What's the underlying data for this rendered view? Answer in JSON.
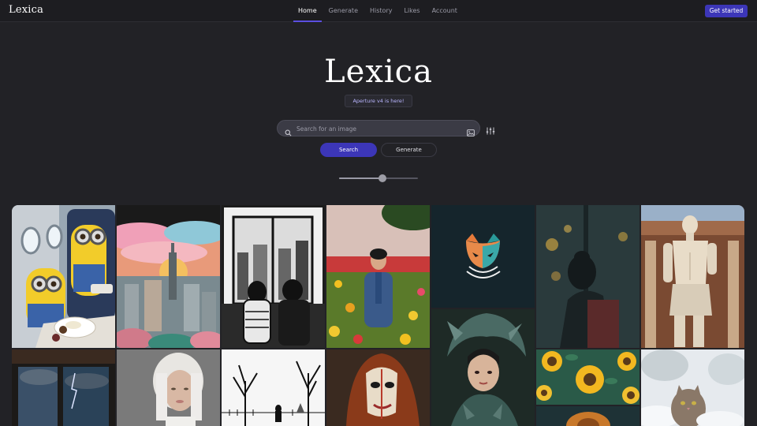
{
  "header": {
    "logo": "Lexica",
    "nav": [
      "Home",
      "Generate",
      "History",
      "Likes",
      "Account"
    ],
    "active_index": 0,
    "cta_label": "Get started"
  },
  "hero": {
    "logo": "Lexica",
    "announcement": "Aperture v4 is here!"
  },
  "search": {
    "placeholder": "Search for an image",
    "search_button": "Search",
    "generate_button": "Generate"
  },
  "size_slider": {
    "value": 0.55
  },
  "gallery": {
    "images": [
      "minions-on-airplane-image",
      "city-sunset-illustration-image",
      "couple-window-sketch-image",
      "man-in-flower-field-image",
      "fox-logo-image",
      "woman-rainy-window-image",
      "marble-statue-image",
      "storm-window-image",
      "platinum-hair-portrait-image",
      "winter-trees-sketch-image",
      "jester-mask-image",
      "dragon-armor-woman-image",
      "sunflowers-image",
      "cat-in-snow-image"
    ]
  },
  "colors": {
    "background": "#222226",
    "accent": "#3c36b8",
    "nav_underline": "#5b4fe0"
  }
}
